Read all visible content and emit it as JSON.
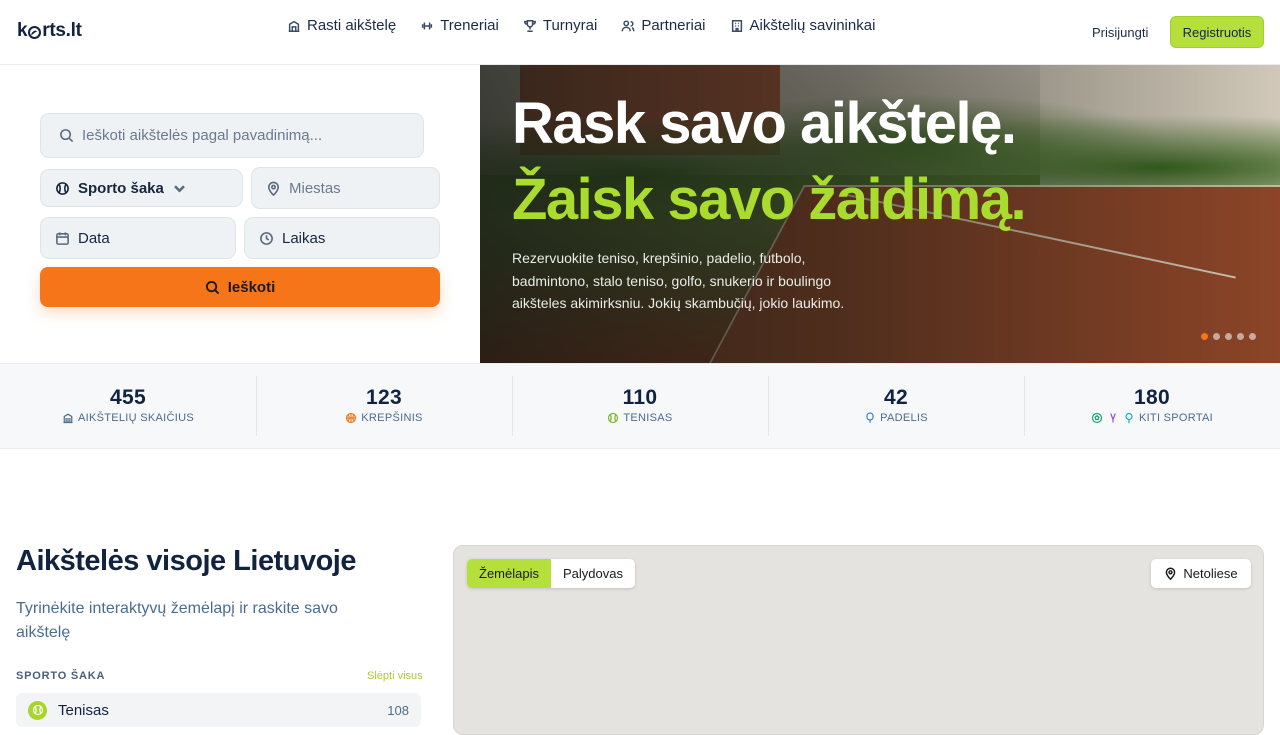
{
  "header": {
    "logo": "korts.lt",
    "logo_prefix": "k",
    "logo_suffix": "rts.lt",
    "nav": [
      {
        "label": "Rasti aikštelę",
        "icon": "building-icon"
      },
      {
        "label": "Treneriai",
        "icon": "dumbbell-icon"
      },
      {
        "label": "Turnyrai",
        "icon": "trophy-icon"
      },
      {
        "label": "Partneriai",
        "icon": "users-icon"
      },
      {
        "label": "Aikštelių savininkai",
        "icon": "building-icon"
      }
    ],
    "login": "Prisijungti",
    "register": "Registruotis",
    "accent": "#b5df3a"
  },
  "search": {
    "placeholder": "Ieškoti aikštelės pagal pavadinimą...",
    "sport": "Sporto šaka",
    "city": "Miestas",
    "date": "Data",
    "time": "Laikas",
    "button": "Ieškoti",
    "button_color": "#f77519"
  },
  "hero": {
    "title": "Rask savo aikštelę.",
    "subtitle": "Žaisk savo žaidimą.",
    "text": "Rezervuokite teniso, krepšinio, padelio, futbolo, badmintono, stalo teniso, golfo, snukerio ir boulingo aikšteles akimirksniu. Jokių skambučių, jokio laukimo.",
    "slides": 5,
    "active_slide": 1
  },
  "stats": [
    {
      "value": "455",
      "label": "Aikštelių skaičius",
      "icon": "building-icon"
    },
    {
      "value": "123",
      "label": "Krepšinis",
      "icon": "basketball-icon"
    },
    {
      "value": "110",
      "label": "Tenisas",
      "icon": "tennis-ball-icon"
    },
    {
      "value": "42",
      "label": "Padelis",
      "icon": "padel-racket-icon"
    },
    {
      "value": "180",
      "label": "Kiti sportai",
      "icon": "multi-sport-icon"
    }
  ],
  "section": {
    "title": "Aikštelės visoje Lietuvoje",
    "subtitle": "Tyrinėkite interaktyvų žemėlapį ir raskite savo aikštelę",
    "filter_header": "SPORTO ŠAKA",
    "hide_all": "Slėpti visus",
    "sports": [
      {
        "name": "Tenisas",
        "count": "108"
      }
    ]
  },
  "map": {
    "tabs": [
      "Žemėlapis",
      "Palydovas"
    ],
    "active_tab": "Žemėlapis",
    "nearby": "Netoliese"
  }
}
